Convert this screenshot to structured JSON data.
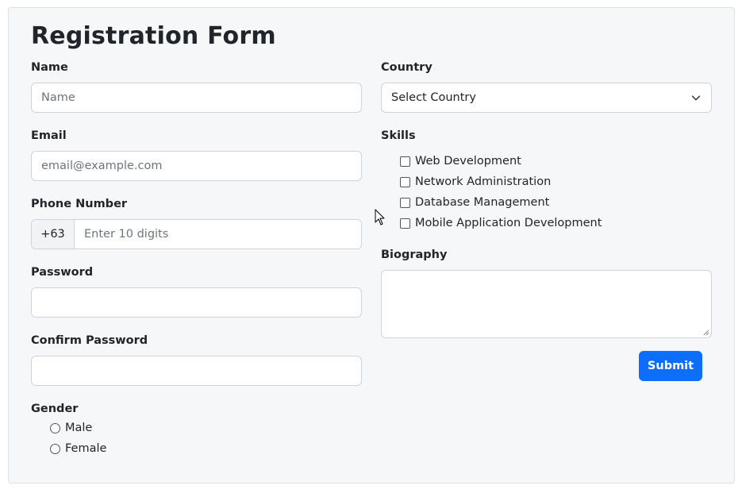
{
  "form": {
    "title": "Registration Form",
    "submit_label": "Submit"
  },
  "fields": {
    "name": {
      "label": "Name",
      "placeholder": "Name",
      "value": ""
    },
    "email": {
      "label": "Email",
      "placeholder": "email@example.com",
      "value": ""
    },
    "phone": {
      "label": "Phone Number",
      "prefix": "+63",
      "placeholder": "Enter 10 digits",
      "value": ""
    },
    "password": {
      "label": "Password",
      "value": ""
    },
    "confirm_password": {
      "label": "Confirm Password",
      "value": ""
    },
    "gender": {
      "label": "Gender",
      "options": [
        "Male",
        "Female"
      ]
    },
    "country": {
      "label": "Country",
      "selected": "Select Country"
    },
    "skills": {
      "label": "Skills",
      "options": [
        "Web Development",
        "Network Administration",
        "Database Management",
        "Mobile Application Development"
      ]
    },
    "biography": {
      "label": "Biography",
      "value": ""
    }
  },
  "colors": {
    "primary": "#0d6efd",
    "card_bg": "#f6f7f9",
    "border": "#ced4da"
  },
  "icons": {
    "select_arrow": "chevron-down-icon",
    "cursor": "mouse-pointer-icon",
    "resize": "resize-grip-icon"
  }
}
